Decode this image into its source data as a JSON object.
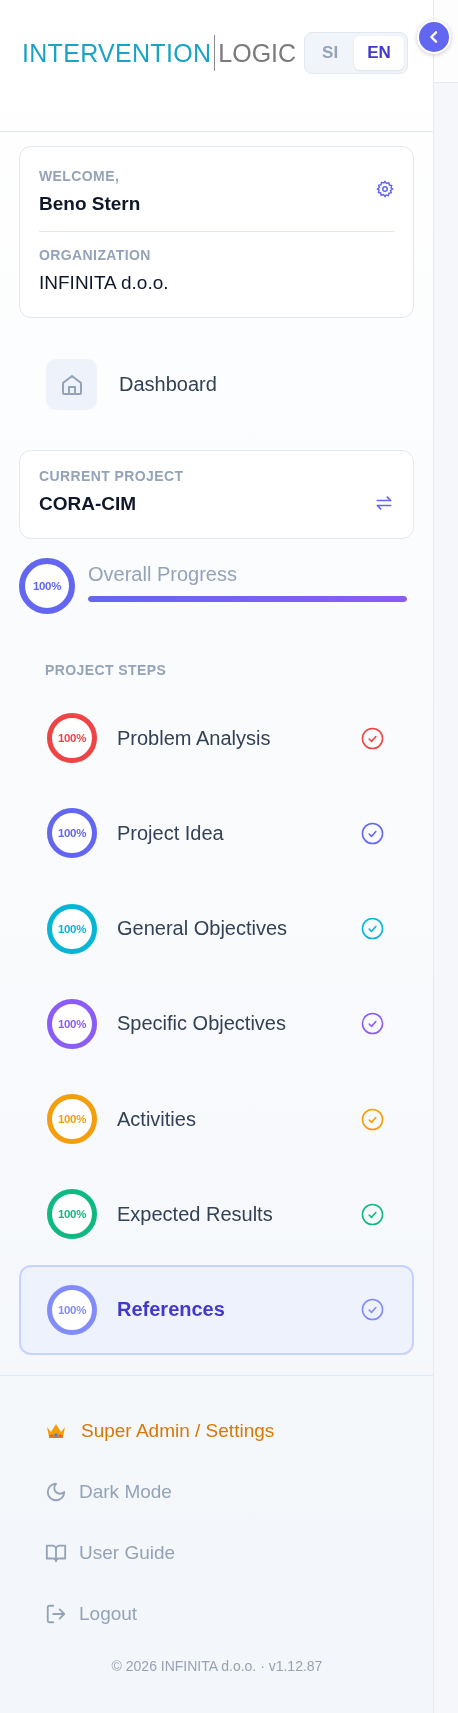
{
  "logo": {
    "primary": "INTERVENTION",
    "secondary": "LOGIC"
  },
  "languages": [
    {
      "label": "SI",
      "selected": false
    },
    {
      "label": "EN",
      "selected": true
    }
  ],
  "user_card": {
    "welcome_label": "WELCOME,",
    "user_name": "Beno Stern",
    "organization_label": "ORGANIZATION",
    "organization": "INFINITA d.o.o."
  },
  "nav": {
    "label": "Dashboard"
  },
  "project": {
    "label": "CURRENT PROJECT",
    "name": "CORA-CIM"
  },
  "overall_progress": {
    "percent": "100%",
    "label": "Overall Progress",
    "level": 1
  },
  "steps_heading": "PROJECT STEPS",
  "steps": [
    {
      "name": "Problem Analysis",
      "percent": "100%",
      "color": "#ef4444",
      "level": 1,
      "completed": true,
      "selected": false
    },
    {
      "name": "Project Idea",
      "percent": "100%",
      "color": "#6366f1",
      "level": 1,
      "completed": true,
      "selected": false
    },
    {
      "name": "General Objectives",
      "percent": "100%",
      "color": "#06b6d4",
      "level": 1,
      "completed": true,
      "selected": false
    },
    {
      "name": "Specific Objectives",
      "percent": "100%",
      "color": "#8b5cf6",
      "level": 1,
      "completed": true,
      "selected": false
    },
    {
      "name": "Activities",
      "percent": "100%",
      "color": "#f59e0b",
      "level": 1,
      "completed": true,
      "selected": false
    },
    {
      "name": "Expected Results",
      "percent": "100%",
      "color": "#10b981",
      "level": 1,
      "completed": true,
      "selected": false
    },
    {
      "name": "References",
      "percent": "100%",
      "color": "#818cf8",
      "level": 1,
      "completed": true,
      "selected": true
    }
  ],
  "menu": [
    {
      "kind": "admin",
      "label": "Super Admin / Settings"
    },
    {
      "kind": "dark_mode",
      "label": "Dark Mode"
    },
    {
      "kind": "guide",
      "label": "User Guide"
    },
    {
      "kind": "logout",
      "label": "Logout"
    }
  ],
  "footer": "© 2026 INFINITA d.o.o. · v1.12.87"
}
